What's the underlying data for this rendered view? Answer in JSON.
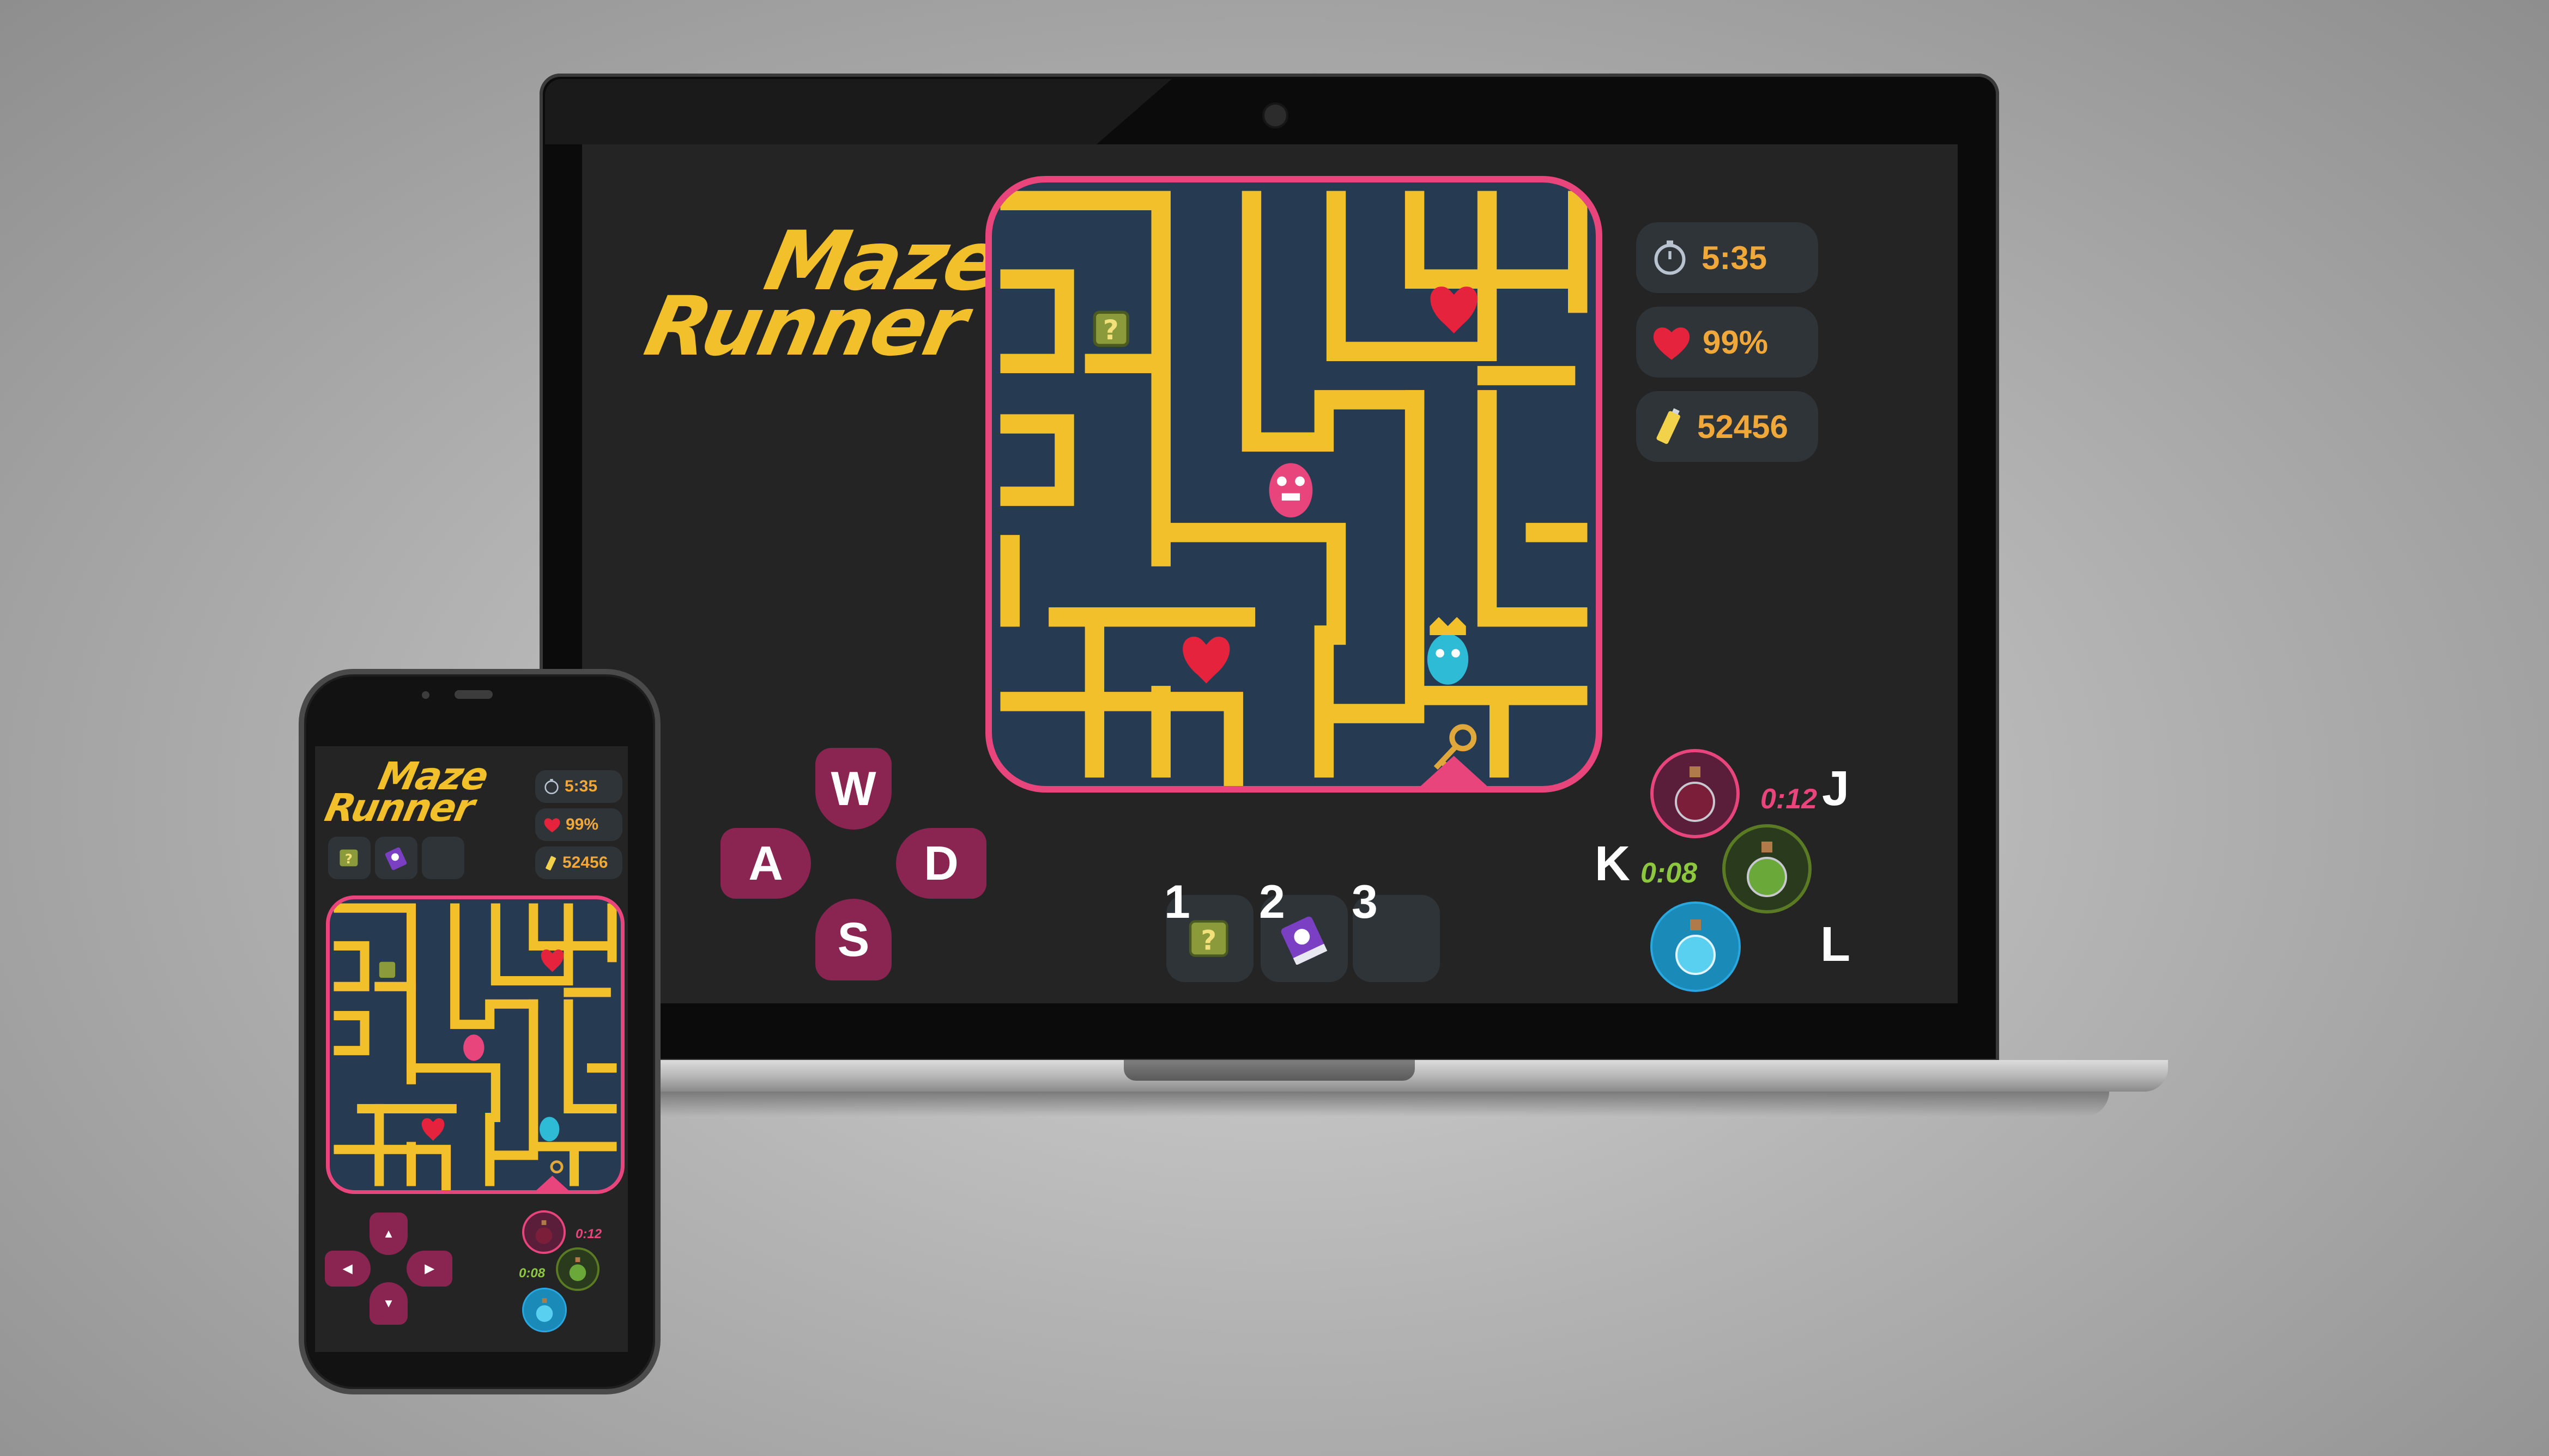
{
  "game": {
    "title_line1": "Maze",
    "title_line2": "Runner"
  },
  "hud": {
    "time": "5:35",
    "health": "99%",
    "score": "52456",
    "stopwatch_icon": "stopwatch-icon",
    "heart_icon": "heart-icon",
    "battery_icon": "battery-icon"
  },
  "controls": {
    "up": "W",
    "left": "A",
    "right": "D",
    "down": "S"
  },
  "inventory": {
    "slot1_label": "1",
    "slot2_label": "2",
    "slot3_label": "3",
    "slot1_item": "mystery-box-icon",
    "slot2_item": "spell-book-icon"
  },
  "potions": {
    "red": {
      "key": "J",
      "cooldown": "0:12",
      "color": "#e8457d"
    },
    "green": {
      "key": "K",
      "cooldown": "0:08",
      "color": "#8dc63f"
    },
    "blue": {
      "key": "L",
      "color": "#29a8e0"
    }
  },
  "colors": {
    "wall": "#f2c02a",
    "floor": "#263a52",
    "frame": "#e8457d",
    "panel": "#242424",
    "dpad": "#8a2450"
  }
}
